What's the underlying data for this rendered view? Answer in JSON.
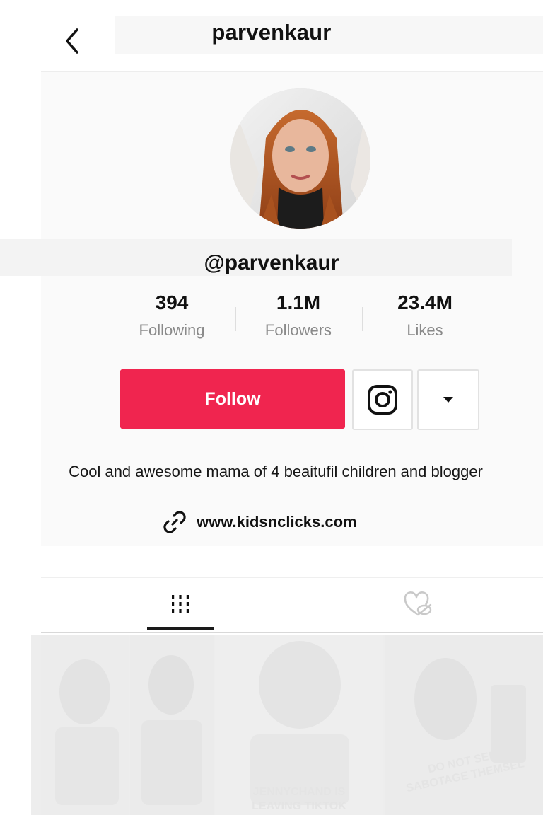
{
  "header": {
    "title": "parvenkaur",
    "back_icon": "chevron-left-icon"
  },
  "profile": {
    "handle": "@parvenkaur",
    "stats": [
      {
        "value": "394",
        "label": "Following"
      },
      {
        "value": "1.1M",
        "label": "Followers"
      },
      {
        "value": "23.4M",
        "label": "Likes"
      }
    ],
    "follow_label": "Follow",
    "instagram_icon": "instagram-icon",
    "more_icon": "caret-down-icon",
    "bio": "Cool and awesome mama of 4 beaitufil children and blogger",
    "link": "www.kidsnclicks.com",
    "link_icon": "link-icon"
  },
  "tabs": [
    {
      "name": "videos",
      "icon": "grid-icon",
      "active": true
    },
    {
      "name": "liked",
      "icon": "heart-hidden-icon",
      "active": false
    }
  ],
  "videos": [
    {
      "caption_lines": [
        "",
        ""
      ]
    },
    {
      "caption_lines": [
        "",
        ""
      ]
    },
    {
      "caption_lines": [
        "JENNYCHAND IS",
        "LEAVING TIKTOK"
      ]
    },
    {
      "caption_lines": [
        "DO NOT SEE",
        "SABOTAGE THEMSEL"
      ]
    }
  ],
  "colors": {
    "accent": "#f0254f",
    "muted": "#8a8a8a"
  }
}
